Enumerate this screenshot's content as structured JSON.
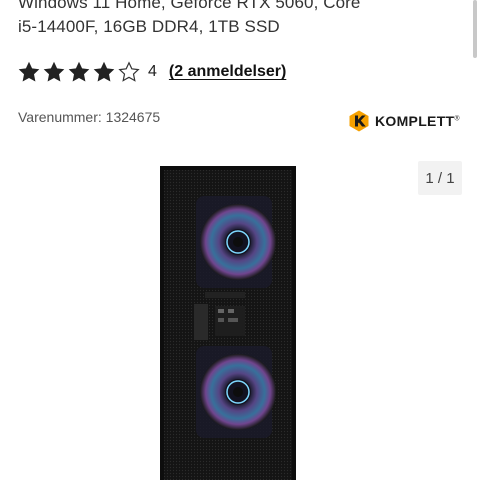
{
  "product": {
    "title_line_1": "Windows 11 Home, Geforce RTX 5060, Core",
    "title_line_2": "i5-14400F, 16GB DDR4, 1TB SSD",
    "rating": {
      "value": "4",
      "stars_filled": 4,
      "stars_total": 5,
      "reviews_label": "(2 anmeldelser)",
      "star_color": "#222222"
    },
    "sku_label": "Varenummer: 1324675",
    "brand": {
      "name": "KOMPLETT",
      "mark": "®",
      "logo_color": "#f5a000"
    },
    "gallery": {
      "counter": "1 / 1"
    }
  }
}
